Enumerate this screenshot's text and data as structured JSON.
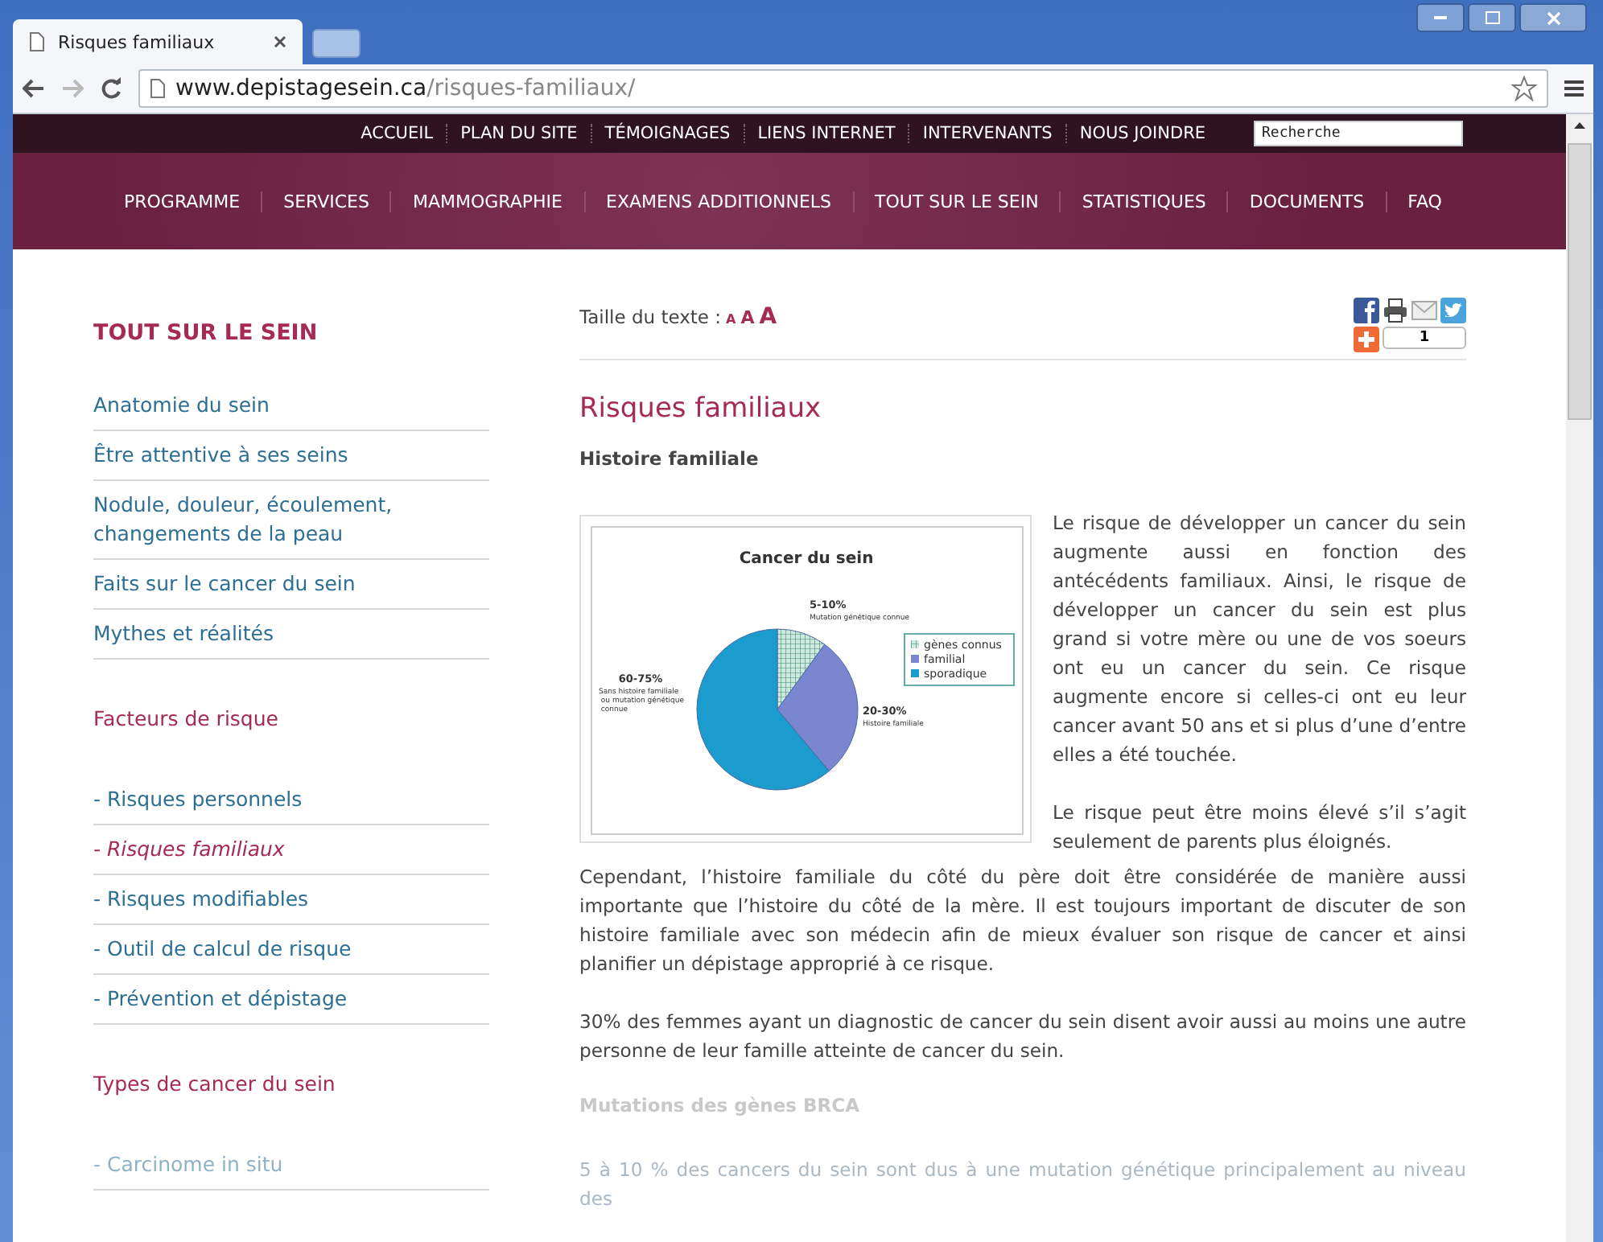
{
  "browser": {
    "tab_title": "Risques familiaux",
    "url_host": "www.depistagesein.ca",
    "url_path": "/risques-familiaux/"
  },
  "top_nav": {
    "items": [
      "ACCUEIL",
      "PLAN DU SITE",
      "TÉMOIGNAGES",
      "LIENS INTERNET",
      "INTERVENANTS",
      "NOUS JOINDRE"
    ],
    "search_placeholder": "Recherche"
  },
  "main_nav": [
    "PROGRAMME",
    "SERVICES",
    "MAMMOGRAPHIE",
    "EXAMENS ADDITIONNELS",
    "TOUT SUR LE SEIN",
    "STATISTIQUES",
    "DOCUMENTS",
    "FAQ"
  ],
  "sidebar": {
    "title": "TOUT SUR LE SEIN",
    "items": [
      {
        "kind": "link",
        "label": "Anatomie du sein",
        "selected": false,
        "faded": false
      },
      {
        "kind": "link",
        "label": "Être attentive à ses seins",
        "selected": false,
        "faded": false
      },
      {
        "kind": "link",
        "label": "Nodule, douleur, écoulement, changements de la peau",
        "selected": false,
        "faded": false
      },
      {
        "kind": "link",
        "label": "Faits sur le cancer du sein",
        "selected": false,
        "faded": false
      },
      {
        "kind": "link",
        "label": "Mythes et réalités",
        "selected": false,
        "faded": false
      },
      {
        "kind": "heading",
        "label": "Facteurs de risque",
        "selected": false,
        "faded": false
      },
      {
        "kind": "sub",
        "label": "- Risques personnels",
        "selected": false,
        "faded": false
      },
      {
        "kind": "sub",
        "label": "- Risques familiaux",
        "selected": true,
        "faded": false
      },
      {
        "kind": "sub",
        "label": "- Risques modifiables",
        "selected": false,
        "faded": false
      },
      {
        "kind": "sub",
        "label": "- Outil de calcul de risque",
        "selected": false,
        "faded": false
      },
      {
        "kind": "sub",
        "label": "- Prévention et dépistage",
        "selected": false,
        "faded": false
      },
      {
        "kind": "heading",
        "label": "Types de cancer du sein",
        "selected": false,
        "faded": false
      },
      {
        "kind": "sub",
        "label": "- Carcinome in situ",
        "selected": false,
        "faded": true
      }
    ]
  },
  "toolbar": {
    "text_size_label": "Taille du texte :",
    "text_sizes": [
      "A",
      "A",
      "A"
    ],
    "share_count": "1"
  },
  "article": {
    "title": "Risques familiaux",
    "subtitle": "Histoire familiale",
    "figure": {
      "title": "Cancer du sein",
      "legend": [
        "gènes connus",
        "familial",
        "sporadique"
      ],
      "slices": [
        {
          "value": "5-10%",
          "caption": "Mutation génétique connue"
        },
        {
          "value": "20-30%",
          "caption": "Histoire familiale"
        },
        {
          "value": "60-75%",
          "caption": "Sans histoire familiale ou mutation génétique connue"
        }
      ]
    },
    "paragraphs": [
      {
        "kind": "text",
        "faded": false,
        "text": "Le risque de développer un cancer du sein augmente aussi en fonction des antécédents familiaux. Ainsi, le risque de développer un cancer du sein est plus grand si votre mère ou une de vos soeurs ont eu un cancer du sein. Ce risque augmente encore si celles-ci ont eu leur cancer avant 50 ans et si plus d’une d’entre elles a été touchée."
      },
      {
        "kind": "text",
        "faded": false,
        "text": "Le risque peut être moins élevé s’il s’agit seulement de parents plus éloignés."
      },
      {
        "kind": "text",
        "faded": false,
        "text": "Cependant, l’histoire familiale du côté du père doit être considérée de manière aussi importante que l’histoire du côté de la mère. Il est toujours important de discuter de son histoire familiale avec son médecin afin de mieux évaluer son risque de cancer et ainsi planifier un dépistage approprié à ce risque."
      },
      {
        "kind": "text",
        "faded": false,
        "text": "30% des femmes ayant un diagnostic de cancer du sein disent avoir aussi au moins une autre personne de leur famille atteinte de cancer du sein."
      },
      {
        "kind": "heading",
        "faded": true,
        "text": "Mutations des gènes BRCA"
      },
      {
        "kind": "text",
        "faded": true,
        "text": "5 à 10 % des cancers du sein sont dus à une mutation génétique principalement au niveau des"
      }
    ]
  }
}
